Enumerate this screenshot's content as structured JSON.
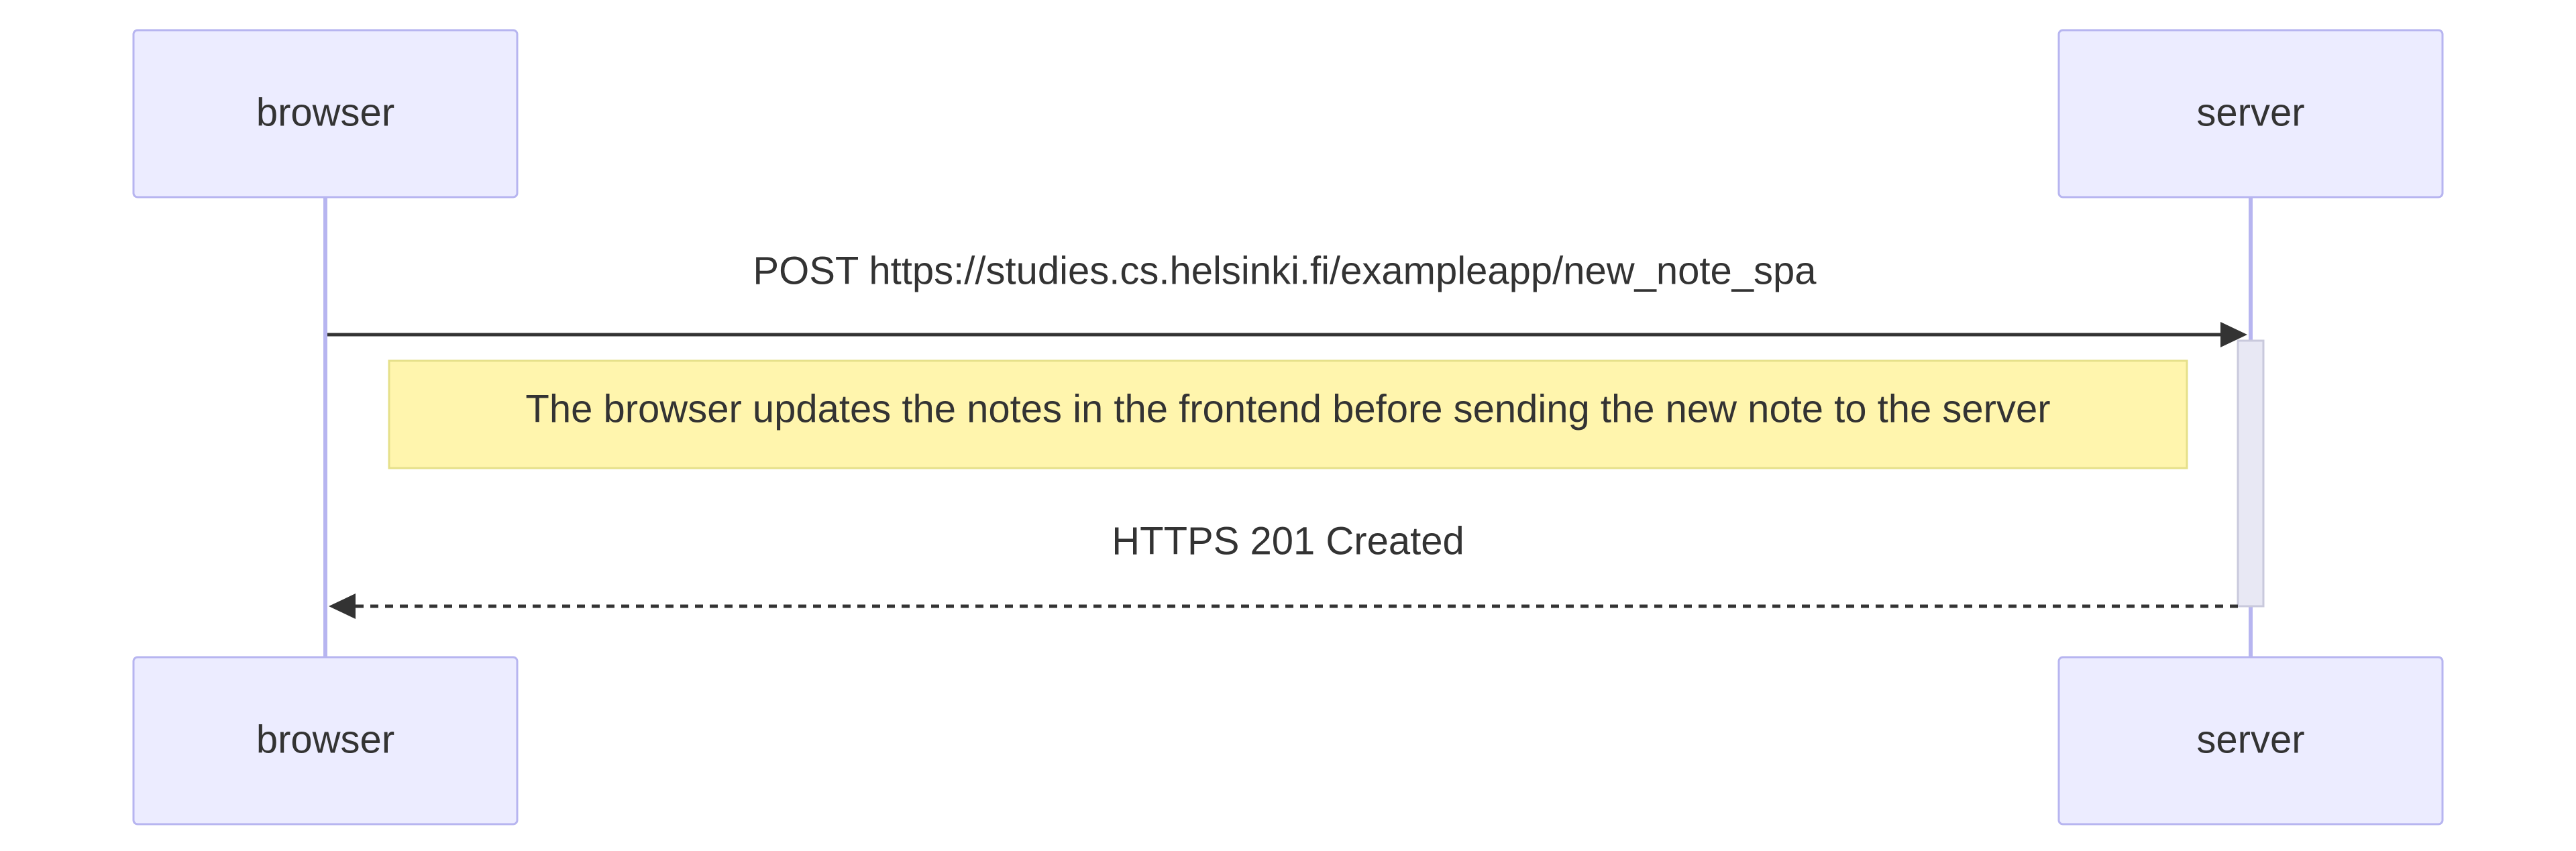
{
  "participants": {
    "left": {
      "name": "browser"
    },
    "right": {
      "name": "server"
    }
  },
  "messages": [
    {
      "from": "browser",
      "to": "server",
      "text": "POST https://studies.cs.helsinki.fi/exampleapp/new_note_spa",
      "style": "solid"
    },
    {
      "from": "server",
      "to": "browser",
      "text": "HTTPS 201 Created",
      "style": "dashed"
    }
  ],
  "note": {
    "text": "The browser updates the notes in the frontend before sending the new note to the server"
  },
  "colors": {
    "actor_fill": "#ececff",
    "actor_stroke": "#b7b5f0",
    "note_fill": "#fff5ad",
    "line": "#333333"
  }
}
